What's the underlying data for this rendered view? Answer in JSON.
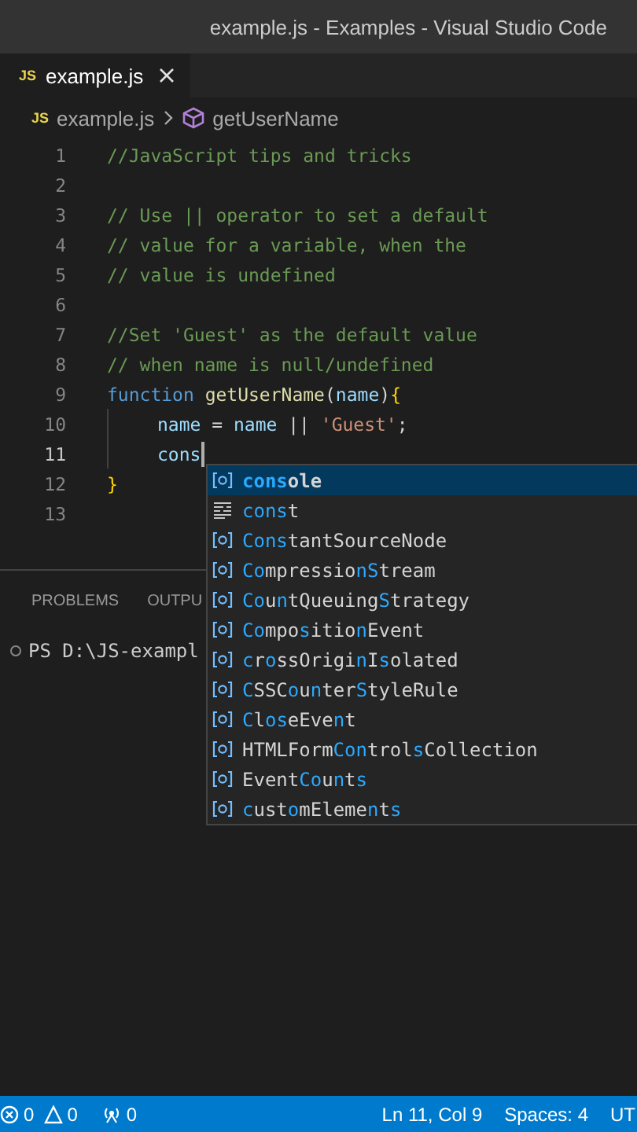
{
  "window": {
    "title": "example.js - Examples - Visual Studio Code"
  },
  "tabs": [
    {
      "label": "example.js",
      "badge": "JS",
      "selected": true
    }
  ],
  "breadcrumb": {
    "file_badge": "JS",
    "file": "example.js",
    "symbol": "getUserName"
  },
  "editor": {
    "lines": [
      {
        "number": "1",
        "current": false,
        "indented": false,
        "tokens": [
          {
            "kind": "comment",
            "text": "//JavaScript tips and tricks"
          }
        ]
      },
      {
        "number": "2",
        "current": false,
        "indented": false
      },
      {
        "number": "3",
        "current": false,
        "indented": false,
        "tokens": [
          {
            "kind": "comment",
            "text": "// Use || operator to set a default"
          }
        ]
      },
      {
        "number": "4",
        "current": false,
        "indented": false,
        "tokens": [
          {
            "kind": "comment",
            "text": "// value for a variable, when the"
          }
        ]
      },
      {
        "number": "5",
        "current": false,
        "indented": false,
        "tokens": [
          {
            "kind": "comment",
            "text": "// value is undefined"
          }
        ]
      },
      {
        "number": "6",
        "current": false,
        "indented": false
      },
      {
        "number": "7",
        "current": false,
        "indented": false,
        "tokens": [
          {
            "kind": "comment",
            "text": "//Set 'Guest' as the default value"
          }
        ]
      },
      {
        "number": "8",
        "current": false,
        "indented": false,
        "tokens": [
          {
            "kind": "comment",
            "text": "// when name is null/undefined"
          }
        ]
      },
      {
        "number": "9",
        "current": false,
        "indented": false,
        "tokens": [
          {
            "kind": "keyword",
            "text": "function "
          },
          {
            "kind": "function",
            "text": "getUserName"
          },
          {
            "kind": "plain",
            "text": "("
          },
          {
            "kind": "variable",
            "text": "name"
          },
          {
            "kind": "plain",
            "text": ")"
          },
          {
            "kind": "bracket",
            "text": "{"
          }
        ]
      },
      {
        "number": "10",
        "current": false,
        "indented": true,
        "tokens": [
          {
            "kind": "variable",
            "text": "name"
          },
          {
            "kind": "plain",
            "text": " = "
          },
          {
            "kind": "variable",
            "text": "name"
          },
          {
            "kind": "plain",
            "text": " || "
          },
          {
            "kind": "string",
            "text": "'Guest'"
          },
          {
            "kind": "plain",
            "text": ";"
          }
        ]
      },
      {
        "number": "11",
        "current": true,
        "indented": true,
        "tokens": [
          {
            "kind": "variable",
            "text": "cons"
          }
        ]
      },
      {
        "number": "12",
        "current": false,
        "indented": false,
        "tokens": [
          {
            "kind": "bracket",
            "text": "}"
          }
        ]
      },
      {
        "number": "13",
        "current": false,
        "indented": false
      }
    ]
  },
  "suggestions": [
    {
      "kind": "variable",
      "selected": true,
      "parts": [
        {
          "text": "cons",
          "match": true
        },
        {
          "text": "ole",
          "match": false
        }
      ]
    },
    {
      "kind": "snippet",
      "selected": false,
      "parts": [
        {
          "text": "cons",
          "match": true
        },
        {
          "text": "t",
          "match": false
        }
      ]
    },
    {
      "kind": "variable",
      "selected": false,
      "parts": [
        {
          "text": "Cons",
          "match": true
        },
        {
          "text": "tantSourceNode",
          "match": false
        }
      ]
    },
    {
      "kind": "variable",
      "selected": false,
      "parts": [
        {
          "text": "Co",
          "match": true
        },
        {
          "text": "mpressio",
          "match": false
        },
        {
          "text": "n",
          "match": true
        },
        {
          "text": "S",
          "match": true
        },
        {
          "text": "tream",
          "match": false
        }
      ]
    },
    {
      "kind": "variable",
      "selected": false,
      "parts": [
        {
          "text": "Co",
          "match": true
        },
        {
          "text": "u",
          "match": false
        },
        {
          "text": "n",
          "match": true
        },
        {
          "text": "tQueuing",
          "match": false
        },
        {
          "text": "S",
          "match": true
        },
        {
          "text": "trategy",
          "match": false
        }
      ]
    },
    {
      "kind": "variable",
      "selected": false,
      "parts": [
        {
          "text": "Co",
          "match": true
        },
        {
          "text": "mpo",
          "match": false
        },
        {
          "text": "s",
          "match": true
        },
        {
          "text": "itio",
          "match": false
        },
        {
          "text": "n",
          "match": true
        },
        {
          "text": "Event",
          "match": false
        }
      ]
    },
    {
      "kind": "variable",
      "selected": false,
      "parts": [
        {
          "text": "c",
          "match": true
        },
        {
          "text": "r",
          "match": false
        },
        {
          "text": "o",
          "match": true
        },
        {
          "text": "ssOrigi",
          "match": false
        },
        {
          "text": "n",
          "match": true
        },
        {
          "text": "I",
          "match": false
        },
        {
          "text": "s",
          "match": true
        },
        {
          "text": "olated",
          "match": false
        }
      ]
    },
    {
      "kind": "variable",
      "selected": false,
      "parts": [
        {
          "text": "C",
          "match": true
        },
        {
          "text": "SSC",
          "match": false
        },
        {
          "text": "o",
          "match": true
        },
        {
          "text": "u",
          "match": false
        },
        {
          "text": "n",
          "match": true
        },
        {
          "text": "ter",
          "match": false
        },
        {
          "text": "S",
          "match": true
        },
        {
          "text": "tyleRule",
          "match": false
        }
      ]
    },
    {
      "kind": "variable",
      "selected": false,
      "parts": [
        {
          "text": "C",
          "match": true
        },
        {
          "text": "l",
          "match": false
        },
        {
          "text": "os",
          "match": true
        },
        {
          "text": "eEve",
          "match": false
        },
        {
          "text": "n",
          "match": true
        },
        {
          "text": "t",
          "match": false
        }
      ]
    },
    {
      "kind": "variable",
      "selected": false,
      "parts": [
        {
          "text": "HTMLForm",
          "match": false
        },
        {
          "text": "Con",
          "match": true
        },
        {
          "text": "trol",
          "match": false
        },
        {
          "text": "s",
          "match": true
        },
        {
          "text": "Collection",
          "match": false
        }
      ]
    },
    {
      "kind": "variable",
      "selected": false,
      "parts": [
        {
          "text": "Event",
          "match": false
        },
        {
          "text": "Co",
          "match": true
        },
        {
          "text": "u",
          "match": false
        },
        {
          "text": "n",
          "match": true
        },
        {
          "text": "t",
          "match": false
        },
        {
          "text": "s",
          "match": true
        }
      ]
    },
    {
      "kind": "variable",
      "selected": false,
      "parts": [
        {
          "text": "c",
          "match": true
        },
        {
          "text": "ust",
          "match": false
        },
        {
          "text": "o",
          "match": true
        },
        {
          "text": "mEleme",
          "match": false
        },
        {
          "text": "n",
          "match": true
        },
        {
          "text": "t",
          "match": false
        },
        {
          "text": "s",
          "match": true
        }
      ]
    }
  ],
  "panel": {
    "tabs": [
      {
        "label": "PROBLEMS",
        "selected": false
      },
      {
        "label": "OUTPU",
        "selected": false
      }
    ],
    "terminal": "PS D:\\JS-exampl"
  },
  "status_bar": {
    "left": [
      {
        "kind": "errors",
        "text": "0"
      },
      {
        "kind": "warnings",
        "text": "0"
      },
      {
        "kind": "ports",
        "text": "0"
      }
    ],
    "right": [
      "Ln 11, Col 9",
      "Spaces: 4",
      "UT"
    ]
  }
}
